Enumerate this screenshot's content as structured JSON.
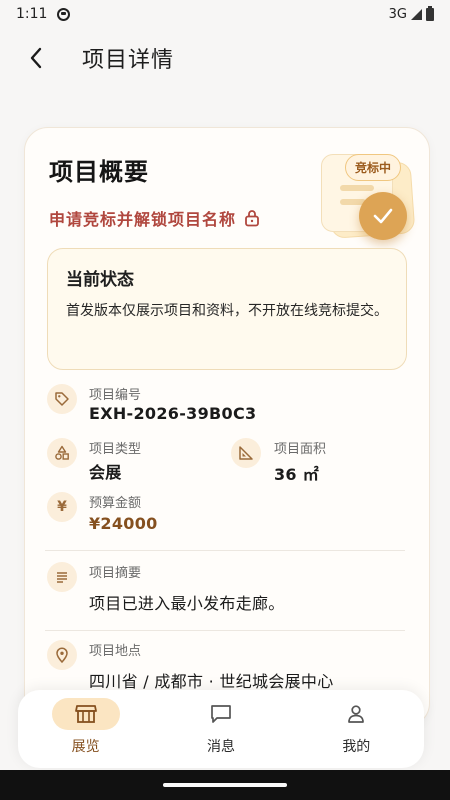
{
  "status_bar": {
    "time": "1:11",
    "network": "3G"
  },
  "header": {
    "title": "项目详情"
  },
  "overview": {
    "title": "项目概要",
    "unlock_label": "申请竞标并解锁项目名称",
    "badge": "竞标中"
  },
  "state": {
    "title": "当前状态",
    "text": "首发版本仅展示项目和资料，不开放在线竞标提交。"
  },
  "fields": {
    "project_no": {
      "label": "项目编号",
      "value": "EXH-2026-39B0C3"
    },
    "project_type": {
      "label": "项目类型",
      "value": "会展"
    },
    "project_area": {
      "label": "项目面积",
      "value": "36 ㎡"
    },
    "budget": {
      "label": "预算金额",
      "value": "¥24000"
    },
    "summary": {
      "label": "项目摘要",
      "value": "项目已进入最小发布走廊。"
    },
    "location": {
      "label": "项目地点",
      "value": "四川省 / 成都市 · 世纪城会展中心"
    }
  },
  "nav": {
    "items": [
      {
        "label": "展览",
        "icon": "storefront-icon",
        "active": true
      },
      {
        "label": "消息",
        "icon": "message-icon",
        "active": false
      },
      {
        "label": "我的",
        "icon": "person-icon",
        "active": false
      }
    ]
  },
  "colors": {
    "accent": "#dda455",
    "unlock_text": "#b0473e",
    "money_text": "#85501f",
    "active_nav_bg": "#fbe5c2"
  }
}
